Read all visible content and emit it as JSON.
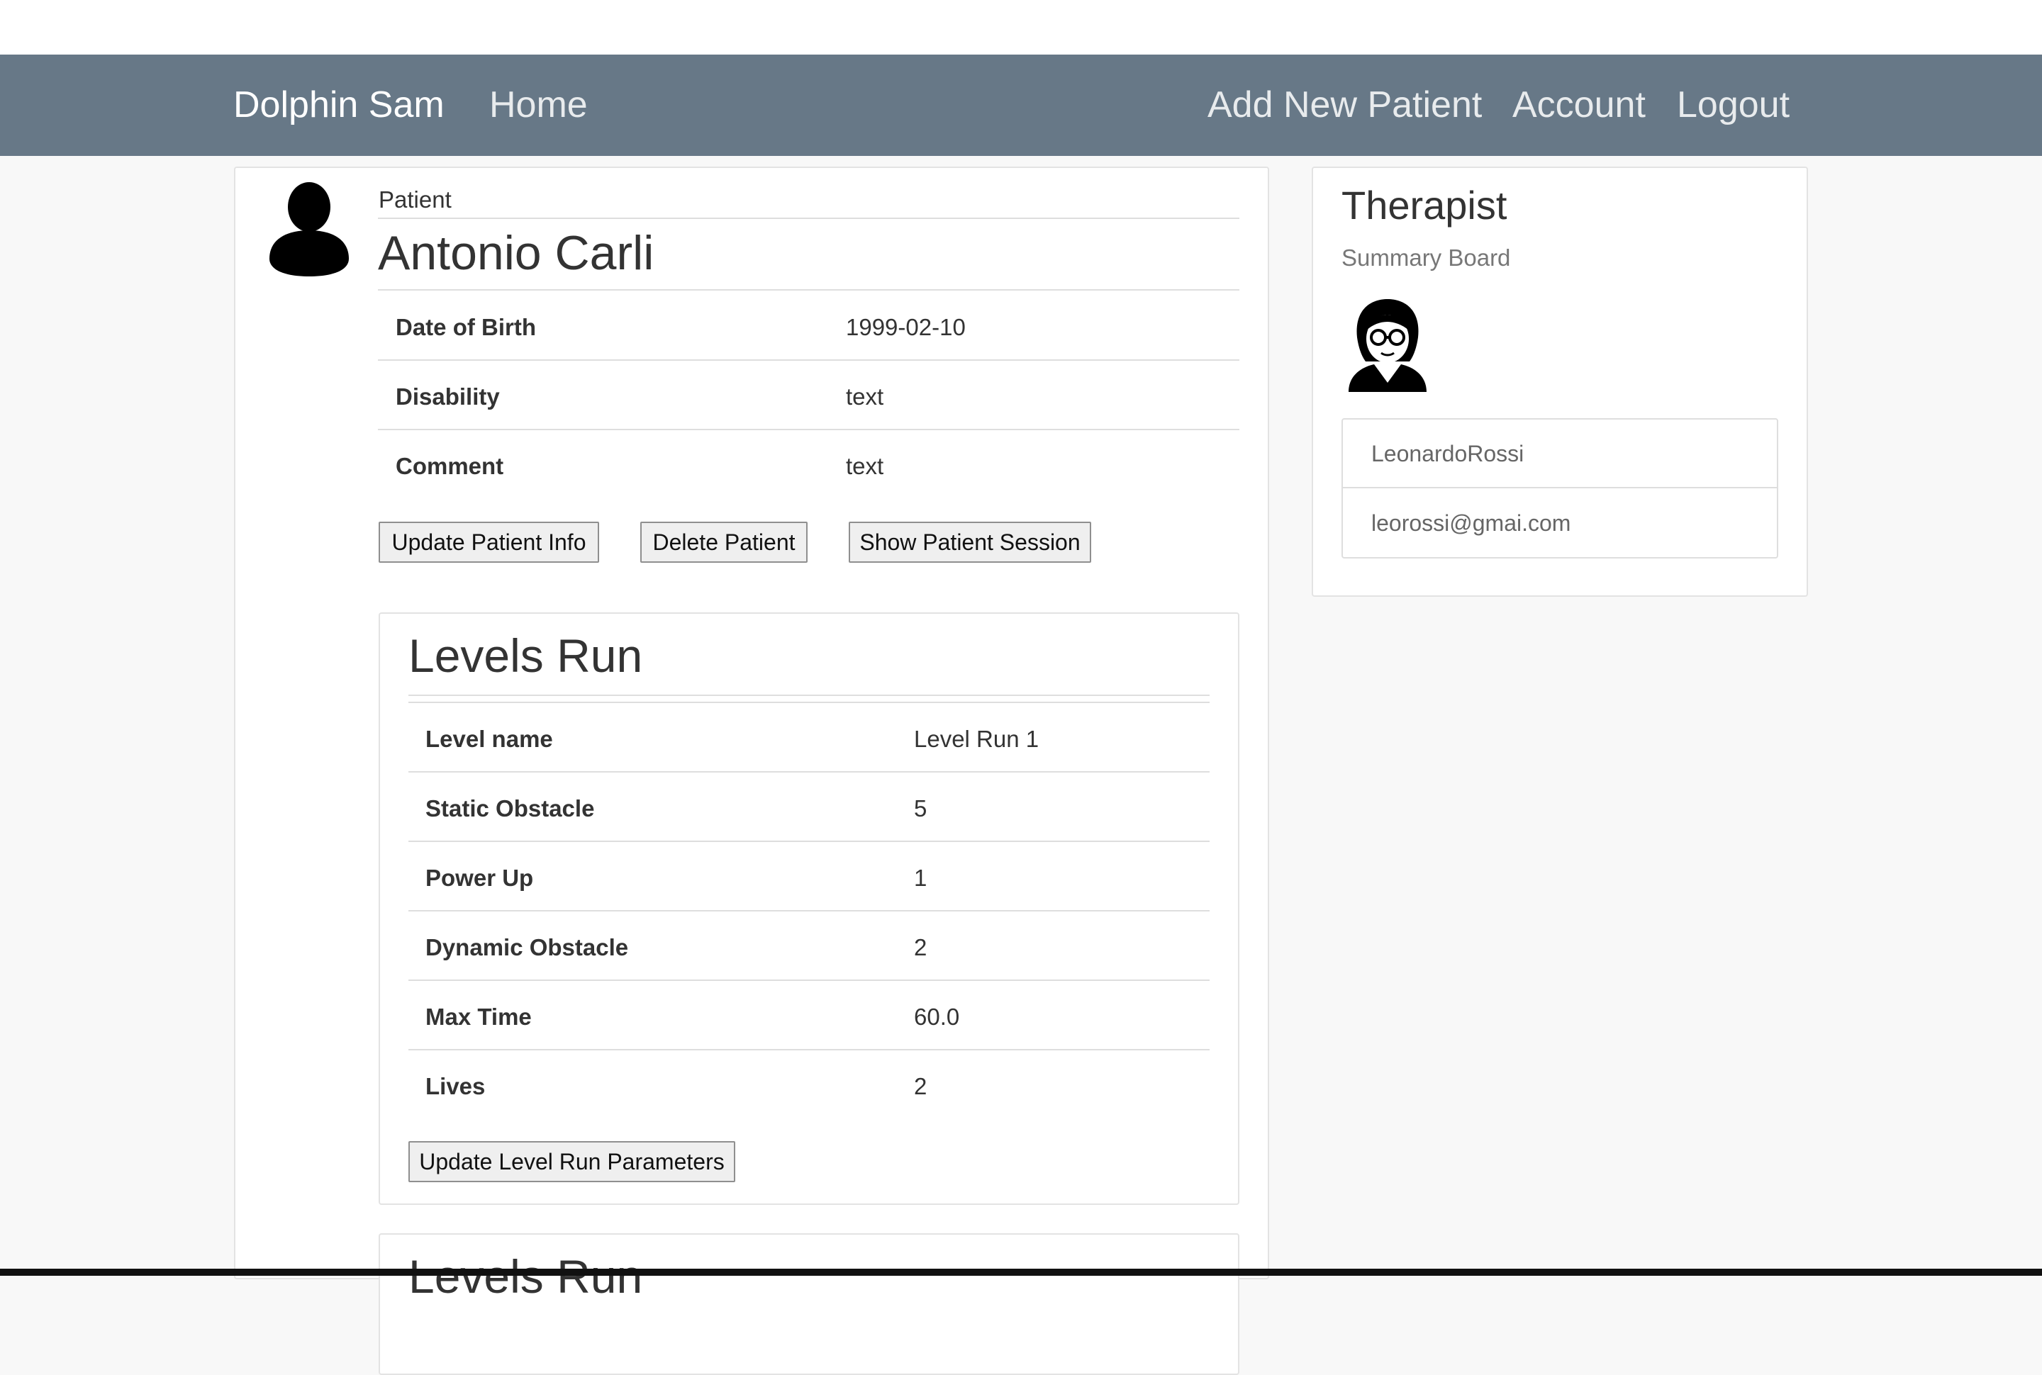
{
  "navbar": {
    "brand": "Dolphin Sam",
    "home": "Home",
    "add_patient": "Add New Patient",
    "account": "Account",
    "logout": "Logout",
    "background_color": "#677887"
  },
  "patient": {
    "label": "Patient",
    "name": "Antonio Carli",
    "details": [
      {
        "label": "Date of Birth",
        "value": "1999-02-10"
      },
      {
        "label": "Disability",
        "value": "text"
      },
      {
        "label": "Comment",
        "value": "text"
      }
    ],
    "buttons": {
      "update": "Update Patient Info",
      "delete": "Delete Patient",
      "show_session": "Show Patient Session"
    }
  },
  "levels_run": [
    {
      "title": "Levels Run",
      "rows": [
        {
          "label": "Level name",
          "value": "Level Run 1"
        },
        {
          "label": "Static Obstacle",
          "value": "5"
        },
        {
          "label": "Power Up",
          "value": "1"
        },
        {
          "label": "Dynamic Obstacle",
          "value": "2"
        },
        {
          "label": "Max Time",
          "value": "60.0"
        },
        {
          "label": "Lives",
          "value": "2"
        }
      ],
      "update_button": "Update Level Run Parameters"
    },
    {
      "title": "Levels Run"
    }
  ],
  "therapist": {
    "title": "Therapist",
    "subtitle": "Summary Board",
    "username": "LeonardoRossi",
    "email": "leorossi@gmai.com"
  },
  "icons": {
    "patient_avatar": "person-silhouette-icon",
    "therapist_avatar": "woman-with-glasses-icon"
  }
}
